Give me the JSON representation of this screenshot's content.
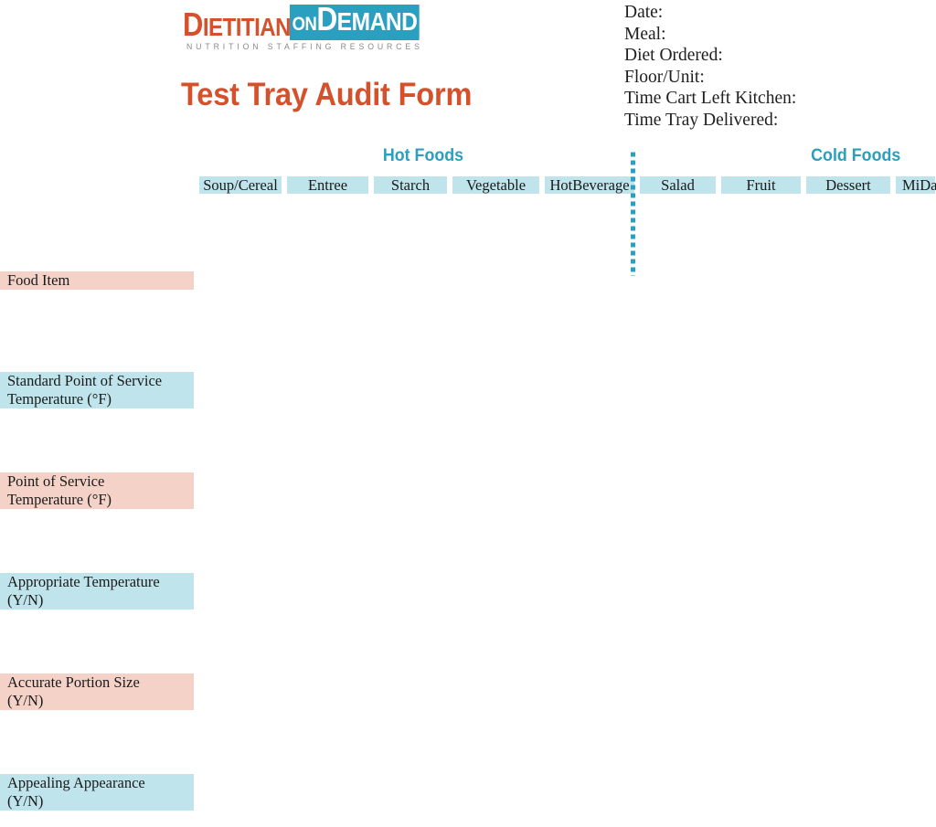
{
  "brand": {
    "logo_part1_cap": "D",
    "logo_part1_rest": "IETITIANS",
    "logo_box_on": "ON",
    "logo_box_cap": "D",
    "logo_box_rest": "EMAND",
    "tagline": "NUTRITION STAFFING RESOURCES",
    "orange": "#D4512C",
    "teal": "#2A9FBF"
  },
  "header": {
    "form_title": "Test Tray Audit Form"
  },
  "meta": {
    "fields": [
      "Date:",
      "Meal:",
      "Diet Ordered:",
      "Floor/Unit:",
      "Time Cart Left Kitchen:",
      "Time Tray Delivered:"
    ]
  },
  "sections": {
    "hot": "Hot Foods",
    "cold": "Cold Foods"
  },
  "table": {
    "corner_label": "",
    "columns": [
      "Soup/\nCereal",
      "Entree",
      "Starch",
      "Vegetable",
      "Hot\nBeverage",
      "Salad",
      "Fruit",
      "Dessert",
      "Milk/\nDairy"
    ],
    "columns_line1": [
      "Soup/",
      "Entree",
      "Starch",
      "Vegetable",
      "Hot",
      "Salad",
      "Fruit",
      "Dessert",
      "Mi"
    ],
    "columns_line2": [
      "Cereal",
      "",
      "",
      "",
      "Beverage",
      "",
      "",
      "",
      "Da"
    ],
    "rows": [
      {
        "label_line1": "Food Item",
        "label_line2": "",
        "fill": "pink"
      },
      {
        "label_line1": "Standard Point of Service",
        "label_line2": "Temperature (°F)",
        "fill": "blue"
      },
      {
        "label_line1": "Point of Service",
        "label_line2": "Temperature (°F)",
        "fill": "pink"
      },
      {
        "label_line1": "Appropriate Temperature",
        "label_line2": "(Y/N)",
        "fill": "blue"
      },
      {
        "label_line1": "Accurate Portion Size",
        "label_line2": "(Y/N)",
        "fill": "pink"
      },
      {
        "label_line1": "Appealing Appearance",
        "label_line2": "(Y/N)",
        "fill": "blue"
      }
    ],
    "colors": {
      "pink": "#F4D2C7",
      "blue": "#BFE4EC"
    }
  }
}
